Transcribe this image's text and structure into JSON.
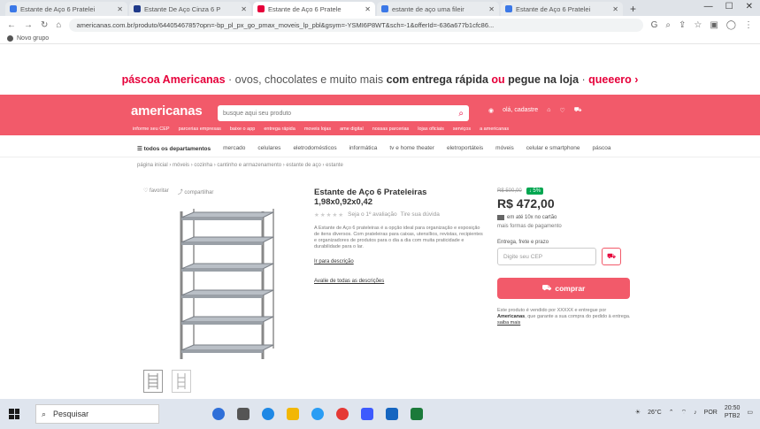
{
  "browser": {
    "tabs": [
      {
        "title": "Estante de Aço 6 Pratelei",
        "fav": "#3b78e7",
        "active": false
      },
      {
        "title": "Estante De Aço Cinza 6 P",
        "fav": "#1f3a8a",
        "active": false
      },
      {
        "title": "Estante de Aço 6 Pratele",
        "fav": "#e6003a",
        "active": true
      },
      {
        "title": "estante de aço uma fileir",
        "fav": "#3b78e7",
        "active": false
      },
      {
        "title": "Estante de Aço 6 Pratelei",
        "fav": "#3b78e7",
        "active": false
      }
    ],
    "new_tab": "+",
    "url": "americanas.com.br/produto/6440546785?opn=-bp_pl_px_go_pmax_moveis_lp_pbl&gsym=-YSMI6P8WT&sch=-1&offerId=-636a677b1cfc86...",
    "bookmark": "Novo grupo"
  },
  "promo": {
    "brand": "páscoa Americanas",
    "sep1": " · ovos, chocolates e muito mais ",
    "bold": "com entrega rápida",
    "or": " ou ",
    "bold2": "pegue na loja",
    "sep2": " · ",
    "cta": "queeero ›"
  },
  "header": {
    "logo": "americanas",
    "search_placeholder": "busque aqui seu produto",
    "account": "olá, cadastre",
    "sub_links": [
      "informe seu CEP",
      "parcerias empresas",
      "baixe o app",
      "entrega rápida",
      "moveis lojas",
      "ame digital",
      "nossas parcerias",
      "lojas oficiais",
      "serviços",
      "a americanas"
    ]
  },
  "departments": {
    "all": "todos os departamentos",
    "items": [
      "mercado",
      "celulares",
      "eletrodomésticos",
      "informática",
      "tv e home theater",
      "eletroportáteis",
      "móveis",
      "celular e smartphone",
      "páscoa"
    ]
  },
  "breadcrumb": "página inicial › móveis › cozinha › cantinho e armazenamento › estante de aço › estante",
  "product": {
    "share": "favoritar",
    "compare": "compartilhar",
    "title": "Estante de Aço 6 Prateleiras 1,98x0,92x0,42",
    "rating_text": "Seja o 1º avaliação",
    "questions": "Tire sua dúvida",
    "description": "A Estante de Aço 6 prateleiras é a opção ideal para organização e exposição de itens diversos. Com prateleiras para caixas, utensílios, revistas, recipientes e organizadores de produtos para o dia a dia com muita praticidade e durabilidade para o lar.",
    "link1": "Ir para descrição",
    "link2": "Avalie de todas as descrições"
  },
  "buy": {
    "old_price": "R$ 500,00",
    "discount": "5%",
    "price": "R$ 472,00",
    "installments": "em até 10x no cartão",
    "minor": "mais formas de pagamento",
    "ship_label": "Entrega, frete e prazo",
    "cep_placeholder": "Digite seu CEP",
    "buy_label": "comprar",
    "note_pre": "Este produto é vendido por XXXXX e entregue por ",
    "note_brand": "Americanas",
    "note_post": ", que garante a sua compra do pedido à entrega. ",
    "note_link": "saiba mais"
  },
  "taskbar": {
    "search": "Pesquisar",
    "weather": "26°C",
    "lang": "POR",
    "time": "20:50",
    "date": "PTB2"
  }
}
